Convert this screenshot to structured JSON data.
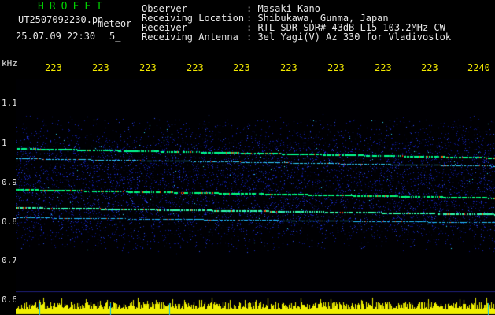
{
  "header": {
    "brand": "HROFFT",
    "filename": "UT2507092230.pn",
    "meteor_label": "meteor",
    "datetime": "25.07.09 22:30",
    "count": "5_",
    "fields": [
      {
        "label": "Observer",
        "value": ": Masaki Kano"
      },
      {
        "label": "Receiving Location",
        "value": ": Shibukawa, Gunma, Japan"
      },
      {
        "label": "Receiver",
        "value": ": RTL-SDR SDR# 43dB L15 103.2MHz CW"
      },
      {
        "label": "Receiving Antenna",
        "value": ": 3el Yagi(V) Az 330 for Vladivostok"
      }
    ]
  },
  "spectrogram": {
    "unit_label": "kHz",
    "y_ticks": [
      "1.1",
      "1",
      "0.9",
      "0.8",
      "0.7",
      "0.6"
    ],
    "x_ticks": [
      "223",
      "223",
      "223",
      "223",
      "223",
      "223",
      "223",
      "223",
      "223",
      "2240"
    ],
    "colors": {
      "background": "#000000",
      "noise": "#1020c0",
      "signal": "#00ff80",
      "peak": "#ff3000",
      "baseline": "#f0f000"
    }
  }
}
